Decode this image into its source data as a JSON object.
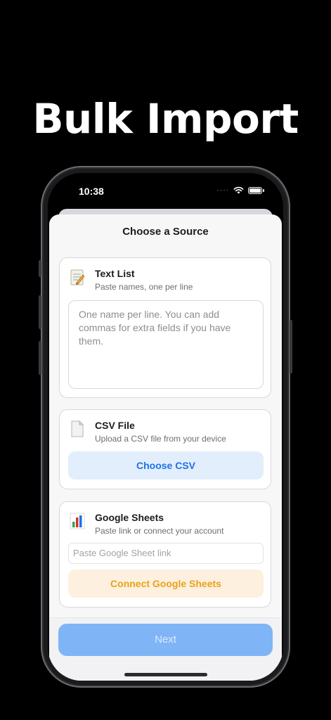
{
  "headline": "Bulk Import",
  "status_bar": {
    "time": "10:38",
    "signal_dots": "····",
    "icons": [
      "wifi-icon",
      "battery-icon"
    ]
  },
  "sheet": {
    "title": "Choose a Source",
    "text_list": {
      "title": "Text List",
      "subtitle": "Paste names, one per line",
      "placeholder": "One name per line. You can add commas for extra fields if you have them.",
      "icon": "notepad-icon"
    },
    "csv": {
      "title": "CSV File",
      "subtitle": "Upload a CSV file from your device",
      "button_label": "Choose CSV",
      "icon": "document-icon"
    },
    "google_sheets": {
      "title": "Google Sheets",
      "subtitle": "Paste link or connect your account",
      "link_placeholder": "Paste Google Sheet link",
      "button_label": "Connect Google Sheets",
      "icon": "bar-chart-icon"
    },
    "next_label": "Next"
  },
  "colors": {
    "accent_blue": "#1a73e8",
    "accent_orange": "#e9a21a",
    "next_disabled": "#7fb5f7"
  }
}
